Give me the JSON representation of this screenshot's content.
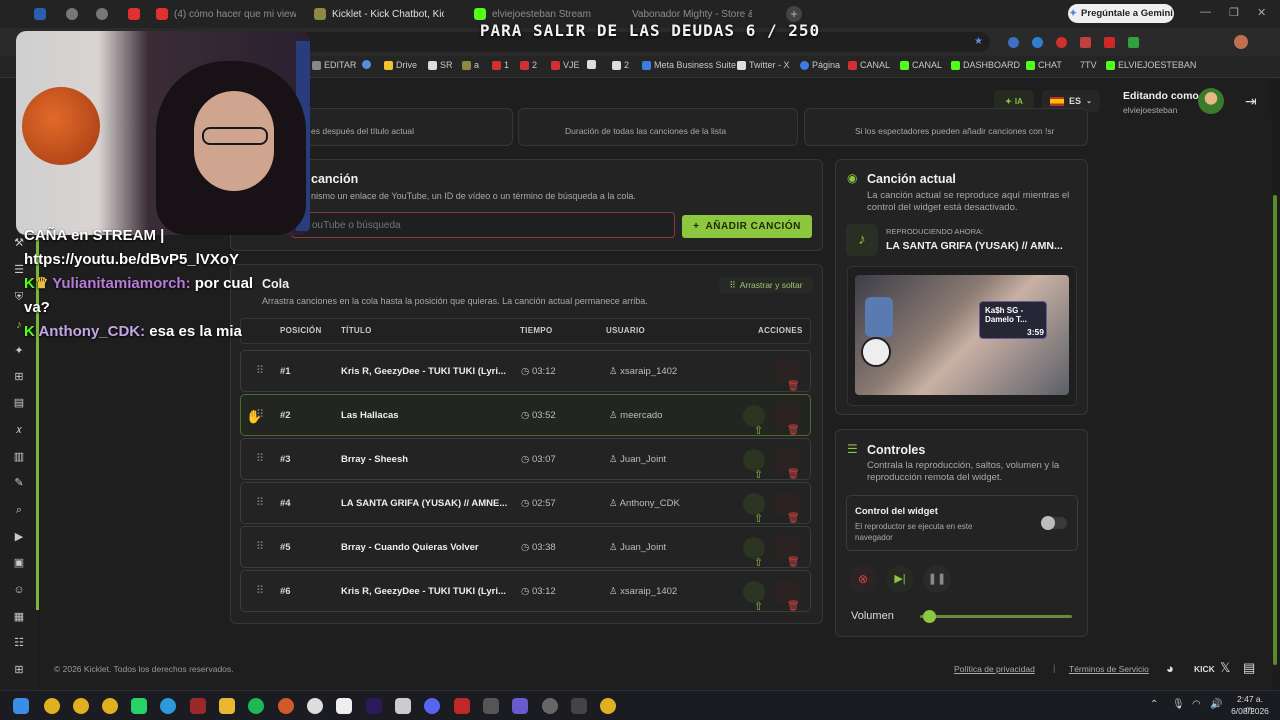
{
  "browser": {
    "tabs": [
      {
        "label": ""
      },
      {
        "label": ""
      },
      {
        "label": ""
      },
      {
        "label": "(4) cómo hacer que mi viewer..."
      },
      {
        "label": "Kicklet - Kick Chatbot, Kick"
      },
      {
        "label": "elviejoesteban Stream - Watch"
      },
      {
        "label": "Vabonador Mighty - Store &"
      }
    ],
    "gemini": "Pregúntale a Gemini",
    "bookmarks": [
      "EDITAR",
      "Drive",
      "SR",
      "a",
      "1",
      "2",
      "VJE",
      "2",
      "Meta Business Suite",
      "Twitter - X",
      "Página",
      "CANAL",
      "CANAL",
      "DASHBOARD",
      "CHAT",
      "7TV",
      "ELVIEJOESTEBAN"
    ]
  },
  "overlay": {
    "title": "PARA SALIR DE LAS DEUDAS 6 / 250",
    "chat": [
      {
        "text": "CAÑA en STREAM |"
      },
      {
        "text": "https://youtu.be/dBvP5_lVXoY"
      },
      {
        "user": "Yulianitamiamorch:",
        "msg": "por cual",
        "cont": "va?",
        "color": "#b87cd8"
      },
      {
        "user": "Anthony_CDK:",
        "msg": "esa es la mia",
        "color": "#c4a6e6"
      }
    ]
  },
  "header": {
    "ia_label": "IA",
    "lang": "ES",
    "editing_label": "Editando como",
    "username": "elviejoesteban"
  },
  "stats": [
    {
      "desc": "es después del título actual"
    },
    {
      "desc": "Duración de todas las canciones de la lista"
    },
    {
      "desc": "Si los espectadores pueden añadir canciones con !sr"
    }
  ],
  "add_song": {
    "title": "canción",
    "desc": "nismo un enlace de YouTube, un ID de vídeo o un término de búsqueda a la cola.",
    "placeholder": "ouTube o búsqueda",
    "button": "AÑADIR CANCIÓN"
  },
  "queue": {
    "title": "Cola",
    "desc": "Arrastra canciones en la cola hasta la posición que quieras. La canción actual permanece arriba.",
    "drag_badge": "Arrastrar y soltar",
    "headers": {
      "pos": "POSICIÓN",
      "title": "TÍTULO",
      "time": "TIEMPO",
      "user": "USUARIO",
      "actions": "ACCIONES"
    },
    "rows": [
      {
        "pos": "#1",
        "title": "Kris R, GeezyDee - TUKI TUKI (Lyri...",
        "time": "03:12",
        "user": "xsaraip_1402"
      },
      {
        "pos": "#2",
        "title": "Las Hallacas",
        "time": "03:52",
        "user": "meercado"
      },
      {
        "pos": "#3",
        "title": "Brray - Sheesh",
        "time": "03:07",
        "user": "Juan_Joint"
      },
      {
        "pos": "#4",
        "title": "LA SANTA GRIFA (YUSAK) // AMNE...",
        "time": "02:57",
        "user": "Anthony_CDK"
      },
      {
        "pos": "#5",
        "title": "Brray - Cuando Quieras Volver",
        "time": "03:38",
        "user": "Juan_Joint"
      },
      {
        "pos": "#6",
        "title": "Kris R, GeezyDee - TUKI TUKI (Lyri...",
        "time": "03:12",
        "user": "xsaraip_1402"
      }
    ]
  },
  "current": {
    "title": "Canción actual",
    "desc": "La canción actual se reproduce aquí mientras el control del widget está desactivado.",
    "now_label": "REPRODUCIENDO AHORA:",
    "now_title": "LA SANTA GRIFA (YUSAK) // AMN...",
    "thumb_caption": "Ka$h SG - Damelo T...",
    "thumb_time": "3:59"
  },
  "controls": {
    "title": "Controles",
    "desc": "Contrala la reproducción, saltos, volumen y la reproducción remota del widget.",
    "widget_title": "Control del widget",
    "widget_desc": "El reproductor se ejecuta en este navegador",
    "widget_enabled": false,
    "volume_label": "Volumen",
    "volume_level": 0.06
  },
  "footer": {
    "copyright": "© 2026 Kicklet. Todos los derechos reservados.",
    "privacy": "Política de privacidad",
    "sep": "|",
    "terms": "Términos de Servicio",
    "kick": "KICK"
  },
  "taskbar": {
    "time": "2:47 a. m.",
    "date": "6/08/2026"
  },
  "colors": {
    "accent": "#8dc63f",
    "danger": "#d24444",
    "bg": "#1d1e1d"
  }
}
